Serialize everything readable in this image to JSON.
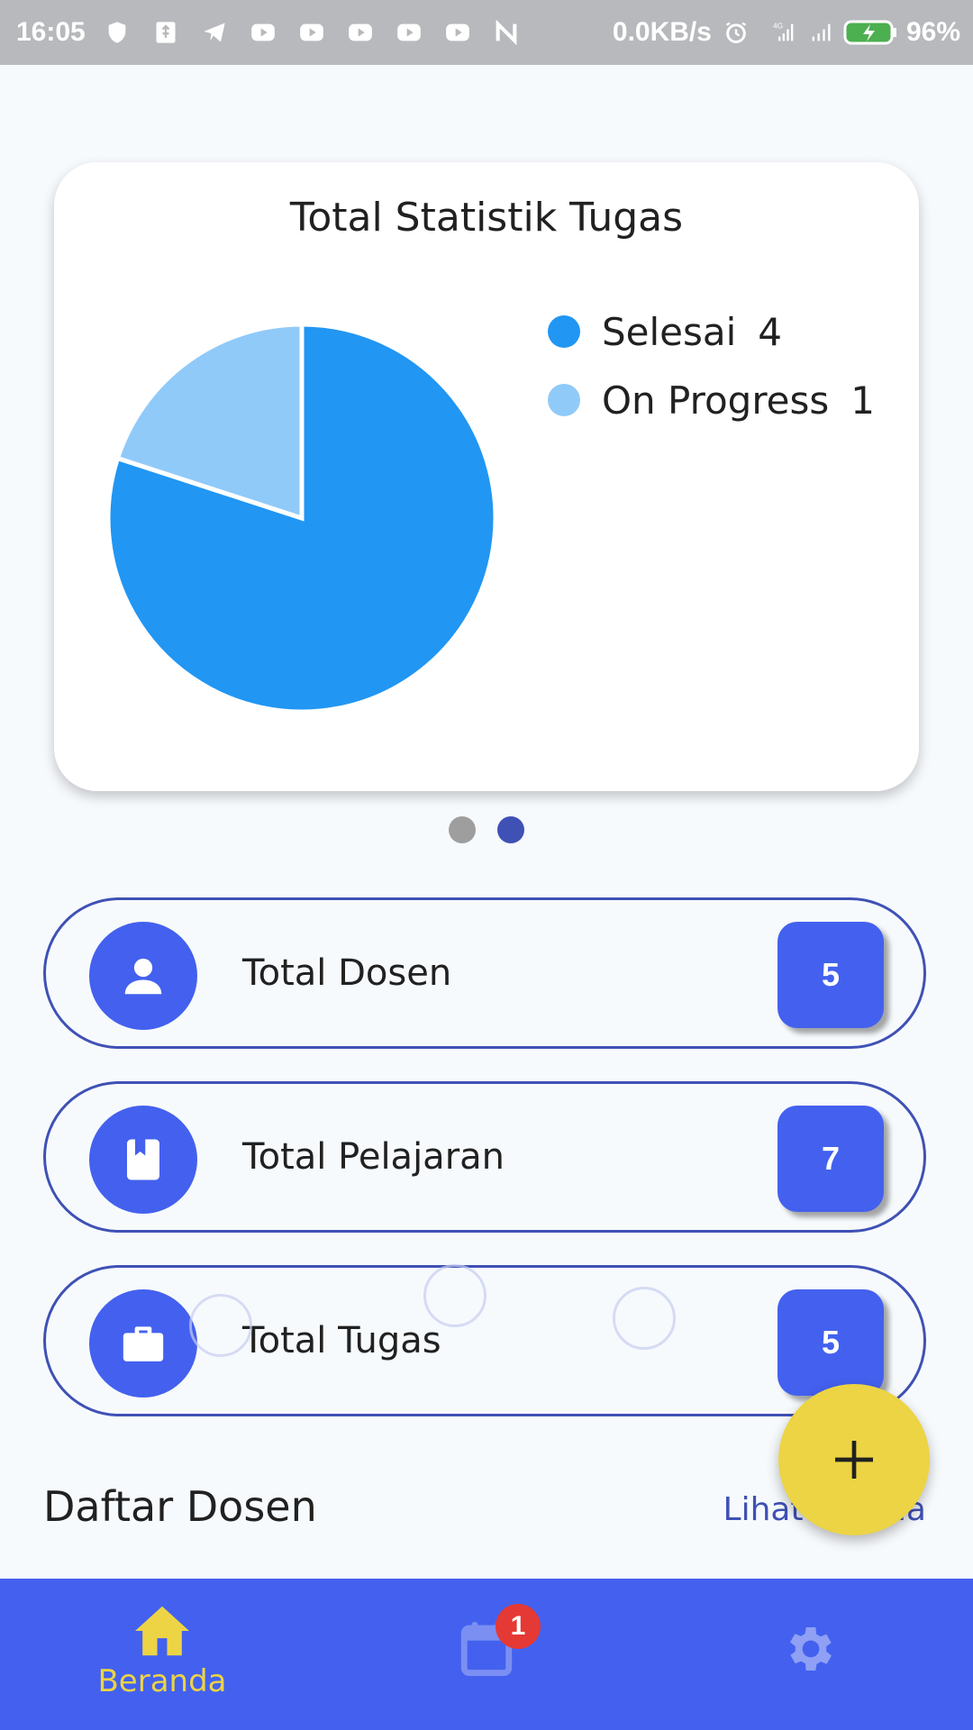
{
  "status_bar": {
    "time": "16:05",
    "network_speed": "0.0KB/s",
    "network_type": "4G",
    "battery": "96%"
  },
  "chart_card": {
    "title": "Total Statistik Tugas"
  },
  "chart_data": {
    "type": "pie",
    "title": "Total Statistik Tugas",
    "categories": [
      "Selesai",
      "On Progress"
    ],
    "values": [
      4,
      1
    ],
    "colors": [
      "#2196F3",
      "#90CAF9"
    ],
    "legend_position": "right"
  },
  "legend": [
    {
      "label": "Selesai",
      "count": "4",
      "color": "#2196F3"
    },
    {
      "label": "On Progress",
      "count": "1",
      "color": "#90CAF9"
    }
  ],
  "carousel": {
    "pages": 2,
    "active_index": 1
  },
  "stats": [
    {
      "label": "Total Dosen",
      "count": "5",
      "icon": "person-icon"
    },
    {
      "label": "Total Pelajaran",
      "count": "7",
      "icon": "book-icon"
    },
    {
      "label": "Total Tugas",
      "count": "5",
      "icon": "briefcase-icon"
    }
  ],
  "section": {
    "title": "Daftar Dosen",
    "link": "Lihat Semua"
  },
  "fab": {
    "icon": "plus-icon"
  },
  "bottom_nav": {
    "items": [
      {
        "label": "Beranda",
        "icon": "home-icon",
        "active": true
      },
      {
        "label": "",
        "icon": "calendar-icon",
        "badge": "1"
      },
      {
        "label": "",
        "icon": "gear-icon"
      }
    ]
  },
  "colors": {
    "primary": "#4361EE",
    "accent": "#ECD444",
    "outline": "#3F51B5",
    "badge": "#E53935"
  }
}
